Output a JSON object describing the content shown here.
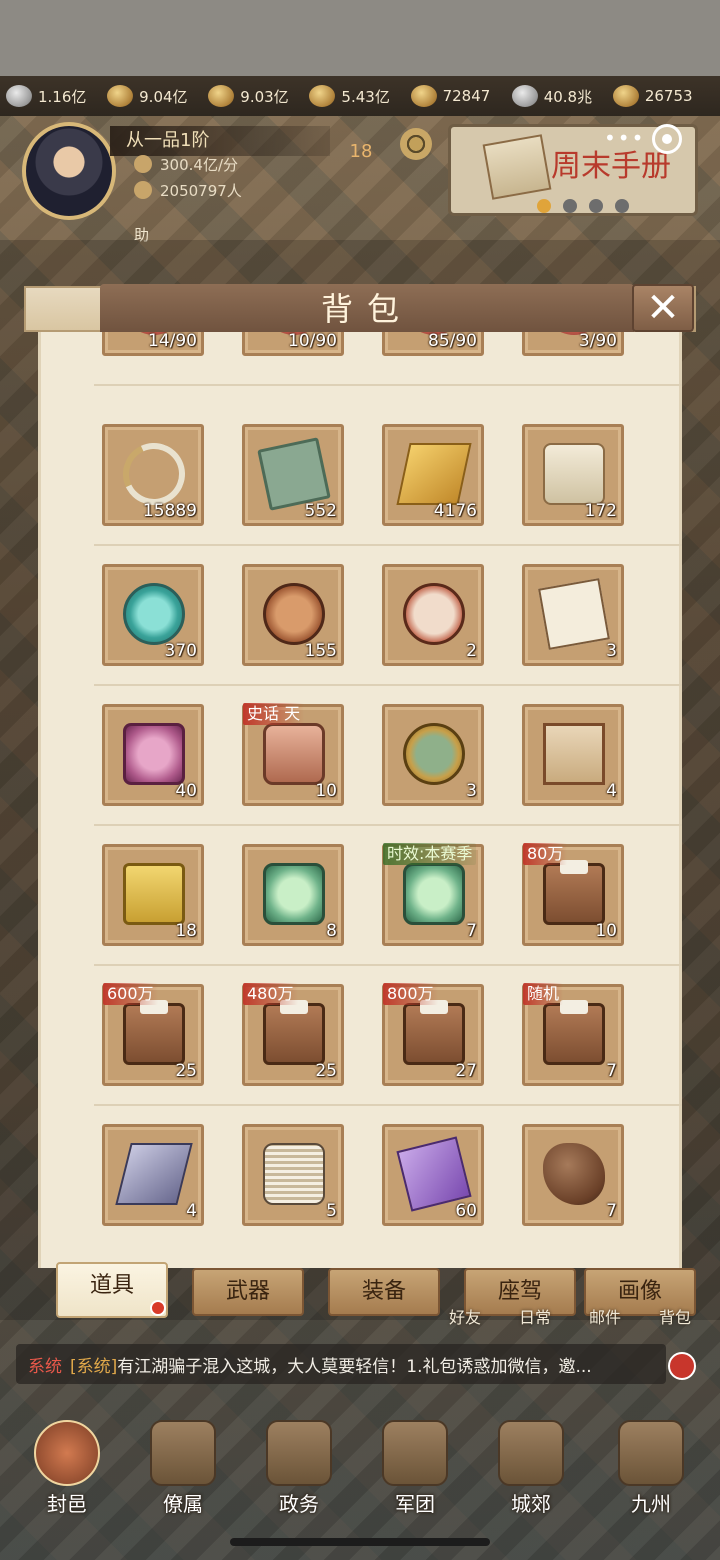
{
  "resources": [
    {
      "icon": "silver-icon",
      "value": "1.16亿"
    },
    {
      "icon": "grain-icon",
      "value": "9.04亿"
    },
    {
      "icon": "soldier-icon",
      "value": "9.03亿"
    },
    {
      "icon": "coin-sack-icon",
      "value": "5.43亿"
    },
    {
      "icon": "gold-coin-icon",
      "value": "72847"
    },
    {
      "icon": "copper-coin-icon",
      "value": "40.8兆"
    },
    {
      "icon": "ingot-icon",
      "value": "26753"
    }
  ],
  "player": {
    "rank": "从一品1阶",
    "income": "300.4亿/分",
    "population": "2050797人",
    "assist_label": "助",
    "level": "18"
  },
  "weekend": {
    "title": "周末手册"
  },
  "modal": {
    "title": "背包",
    "close_label": "✕"
  },
  "partial_items": [
    {
      "count": "14/90"
    },
    {
      "count": "10/90"
    },
    {
      "count": "85/90"
    },
    {
      "count": "3/90"
    }
  ],
  "items": [
    {
      "name": "ribbon-item-icon",
      "count": "15889",
      "tag": ""
    },
    {
      "name": "book-item-icon",
      "count": "552",
      "tag": ""
    },
    {
      "name": "gold-bar-item-icon",
      "count": "4176",
      "tag": ""
    },
    {
      "name": "scroll-hammer-item-icon",
      "count": "172",
      "tag": ""
    },
    {
      "name": "jade-pendant-item-icon",
      "count": "370",
      "tag": ""
    },
    {
      "name": "bronze-coin-item-icon",
      "count": "155",
      "tag": ""
    },
    {
      "name": "drum-item-icon",
      "count": "2",
      "tag": ""
    },
    {
      "name": "letter-item-icon",
      "count": "3",
      "tag": ""
    },
    {
      "name": "pink-token-item-icon",
      "count": "40",
      "tag": ""
    },
    {
      "name": "red-token-item-icon",
      "count": "10",
      "tag": "史话 天"
    },
    {
      "name": "portrait-medal-item-icon",
      "count": "3",
      "tag": ""
    },
    {
      "name": "map-scroll-item-icon",
      "count": "4",
      "tag": ""
    },
    {
      "name": "yellow-token-item-icon",
      "count": "18",
      "tag": ""
    },
    {
      "name": "green-token-item-icon",
      "count": "8",
      "tag": ""
    },
    {
      "name": "green-token-season-item-icon",
      "count": "7",
      "tag": "时效:本赛季",
      "tag_style": "green"
    },
    {
      "name": "chest-item-icon",
      "count": "10",
      "tag": "80万"
    },
    {
      "name": "chest-item-icon",
      "count": "25",
      "tag": "600万"
    },
    {
      "name": "chest-item-icon",
      "count": "25",
      "tag": "480万"
    },
    {
      "name": "chest-item-icon",
      "count": "27",
      "tag": "800万"
    },
    {
      "name": "chest-item-icon",
      "count": "7",
      "tag": "随机"
    },
    {
      "name": "iron-ingot-item-icon",
      "count": "4",
      "tag": ""
    },
    {
      "name": "thread-spool-item-icon",
      "count": "5",
      "tag": ""
    },
    {
      "name": "silk-cloth-item-icon",
      "count": "60",
      "tag": ""
    },
    {
      "name": "ore-stone-item-icon",
      "count": "7",
      "tag": ""
    }
  ],
  "tabs": [
    {
      "label": "道具",
      "active": true
    },
    {
      "label": "武器",
      "active": false
    },
    {
      "label": "装备",
      "active": false
    },
    {
      "label": "座驾",
      "active": false
    },
    {
      "label": "画像",
      "active": false
    }
  ],
  "quick_links": [
    "好友",
    "日常",
    "邮件",
    "背包"
  ],
  "chat": {
    "channel": "系统",
    "source": "[系统]",
    "message": "有江湖骗子混入这城，大人莫要轻信！1.礼包诱惑加微信，邀..."
  },
  "nav": [
    {
      "label": "封邑",
      "active": true
    },
    {
      "label": "僚属",
      "active": false
    },
    {
      "label": "政务",
      "active": false
    },
    {
      "label": "军团",
      "active": false
    },
    {
      "label": "城郊",
      "active": false
    },
    {
      "label": "九州",
      "active": false
    }
  ]
}
